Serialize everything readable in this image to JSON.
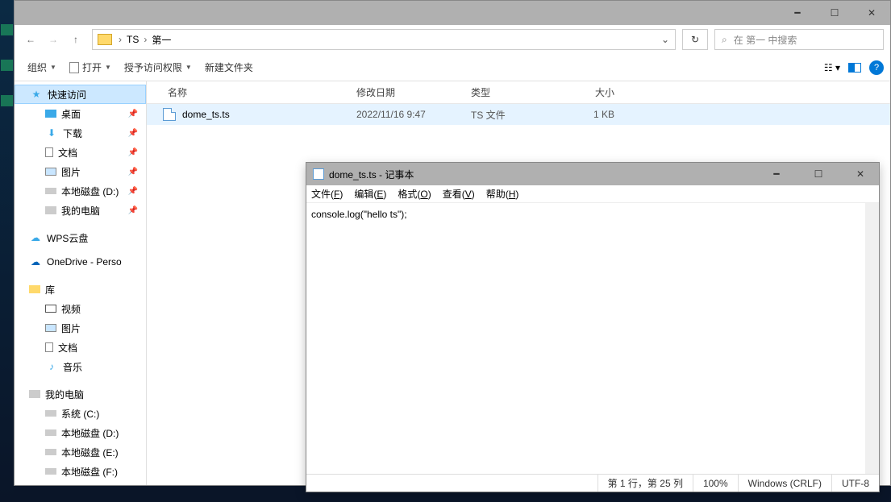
{
  "explorer": {
    "breadcrumbs": [
      "TS",
      "第一"
    ],
    "search_placeholder": "在 第一 中搜索",
    "cmdbar": {
      "organize": "组织",
      "open": "打开",
      "grant": "授予访问权限",
      "newfolder": "新建文件夹"
    },
    "columns": {
      "name": "名称",
      "date": "修改日期",
      "type": "类型",
      "size": "大小"
    },
    "rows": [
      {
        "name": "dome_ts.ts",
        "date": "2022/11/16 9:47",
        "type": "TS 文件",
        "size": "1 KB"
      }
    ],
    "sidebar": {
      "quick": "快速访问",
      "desktop": "桌面",
      "downloads": "下载",
      "documents": "文档",
      "pictures": "图片",
      "diskD": "本地磁盘 (D:)",
      "thispc_q": "我的电脑",
      "wps": "WPS云盘",
      "onedrive": "OneDrive - Perso",
      "library": "库",
      "lib_video": "视频",
      "lib_pic": "图片",
      "lib_doc": "文档",
      "lib_music": "音乐",
      "thispc": "我的电脑",
      "sysC": "系统 (C:)",
      "diskD2": "本地磁盘 (D:)",
      "diskE": "本地磁盘 (E:)",
      "diskF": "本地磁盘 (F:)"
    }
  },
  "notepad": {
    "title": "dome_ts.ts - 记事本",
    "menu": {
      "file": "文件(F)",
      "edit": "编辑(E)",
      "format": "格式(O)",
      "view": "查看(V)",
      "help": "帮助(H)"
    },
    "content": "console.log(\"hello ts\");",
    "status": {
      "pos": "第 1 行，第 25 列",
      "zoom": "100%",
      "eol": "Windows (CRLF)",
      "enc": "UTF-8"
    }
  }
}
